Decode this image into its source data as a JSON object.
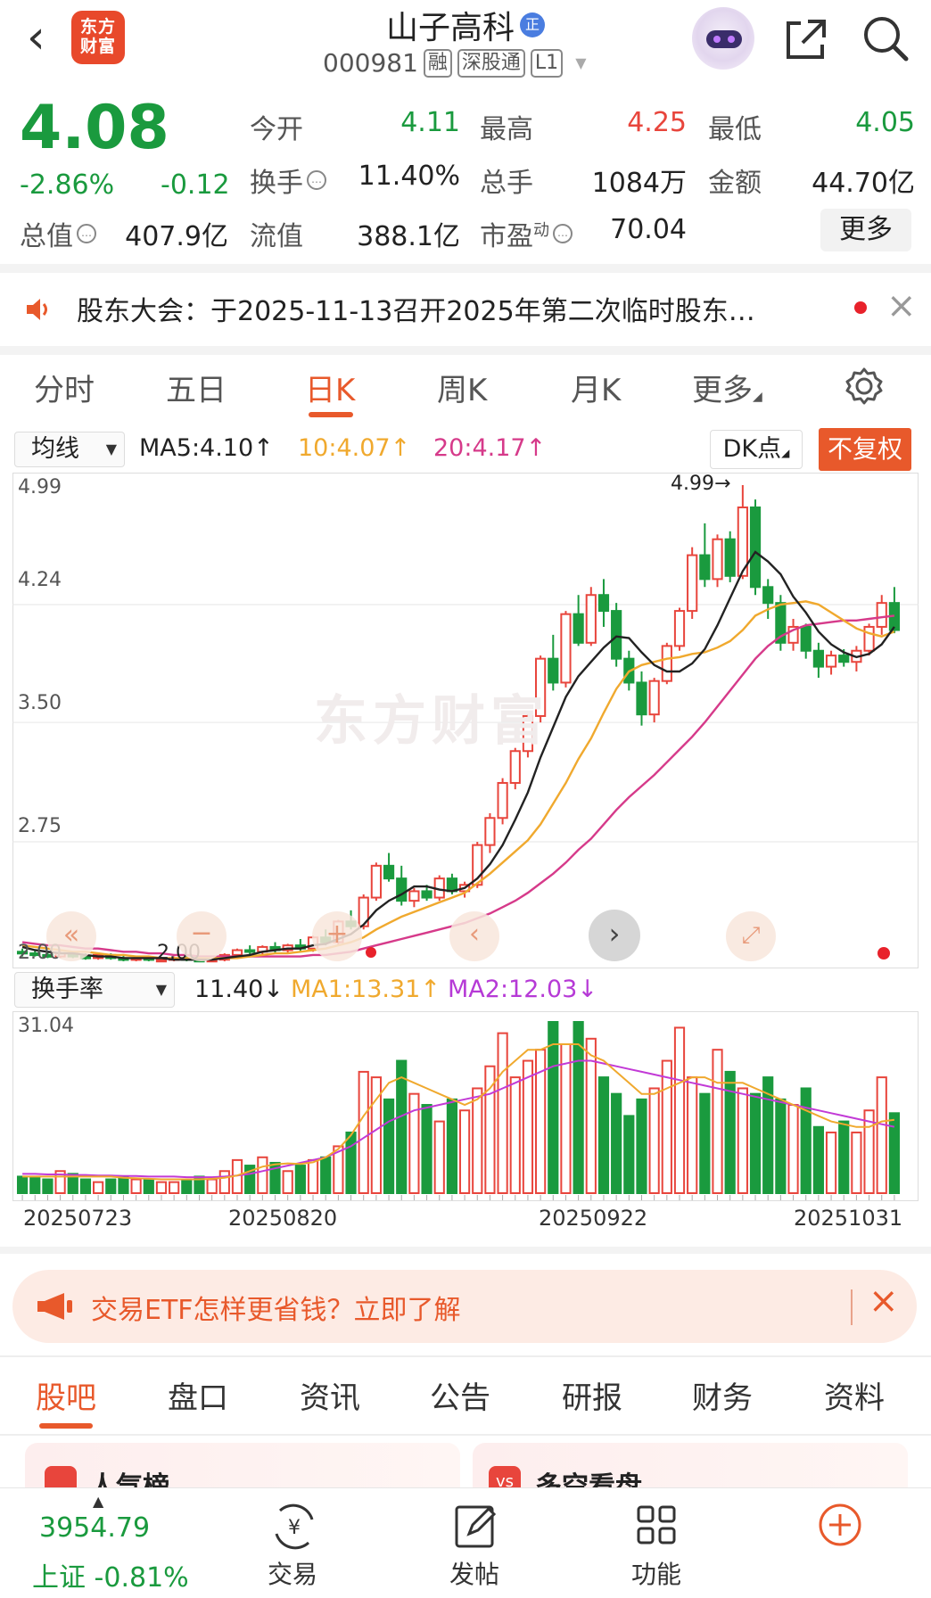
{
  "header": {
    "back": "‹",
    "logo": [
      "东方",
      "财富"
    ],
    "stock_name": "山子高科",
    "zheng_badge": "正",
    "code": "000981",
    "tags": [
      "融",
      "深股通",
      "L1"
    ]
  },
  "quote": {
    "price": "4.08",
    "change_pct": "-2.86%",
    "change": "-0.12",
    "fields": {
      "open_label": "今开",
      "open": "4.11",
      "high_label": "最高",
      "high": "4.25",
      "low_label": "最低",
      "low": "4.05",
      "turnover_label": "换手",
      "turnover": "11.40%",
      "volume_label": "总手",
      "volume": "1084万",
      "amount_label": "金额",
      "amount": "44.70亿",
      "mcap_label": "总值",
      "mcap": "407.9亿",
      "float_label": "流值",
      "float": "388.1亿",
      "pe_label": "市盈",
      "pe_sup": "动",
      "pe": "70.04"
    },
    "more": "更多"
  },
  "notice": {
    "text": "股东大会：于2025-11-13召开2025年第二次临时股东…",
    "close": "×"
  },
  "period_tabs": [
    "分时",
    "五日",
    "日K",
    "周K",
    "月K",
    "更多"
  ],
  "active_period": "日K",
  "ma_row": {
    "select": "均线",
    "ma5": "MA5:4.10↑",
    "ma10": "10:4.07↑",
    "ma20": "20:4.17↑",
    "dk": "DK点",
    "fq": "不复权",
    "colors": {
      "ma5": "#222222",
      "ma10": "#f0a92e",
      "ma20": "#d63a8a"
    }
  },
  "vol_row": {
    "select": "换手率",
    "value": "11.40↓",
    "ma1": "MA1:13.31↑",
    "ma2": "MA2:12.03↓"
  },
  "chart_data": {
    "type": "candlestick",
    "y_axis_labels": [
      "4.99",
      "4.24",
      "3.50",
      "2.75",
      "2.00"
    ],
    "ylim": [
      2.0,
      4.99
    ],
    "max_marker": "4.99→",
    "min_marker": "2.00",
    "watermark": "东方财富",
    "vol_axis_label": "31.04",
    "x_tick_labels": [
      "20250723",
      "20250820",
      "20250922",
      "20251031"
    ],
    "colors": {
      "up": "#e8453c",
      "down": "#1a9a3e"
    },
    "candles": [
      [
        2.06,
        2.08,
        2.03,
        2.05
      ],
      [
        2.05,
        2.07,
        2.03,
        2.04
      ],
      [
        2.04,
        2.06,
        2.02,
        2.03
      ],
      [
        2.03,
        2.06,
        2.02,
        2.05
      ],
      [
        2.05,
        2.06,
        2.02,
        2.03
      ],
      [
        2.03,
        2.05,
        2.01,
        2.02
      ],
      [
        2.02,
        2.05,
        2.01,
        2.04
      ],
      [
        2.04,
        2.05,
        2.01,
        2.02
      ],
      [
        2.02,
        2.04,
        2.0,
        2.01
      ],
      [
        2.01,
        2.03,
        2.0,
        2.02
      ],
      [
        2.02,
        2.03,
        2.0,
        2.01
      ],
      [
        2.01,
        2.02,
        2.0,
        2.01
      ],
      [
        2.01,
        2.03,
        2.0,
        2.02
      ],
      [
        2.02,
        2.03,
        2.0,
        2.01
      ],
      [
        2.01,
        2.02,
        2.0,
        2.0
      ],
      [
        2.0,
        2.02,
        2.0,
        2.01
      ],
      [
        2.01,
        2.05,
        2.0,
        2.04
      ],
      [
        2.04,
        2.08,
        2.02,
        2.07
      ],
      [
        2.07,
        2.1,
        2.04,
        2.06
      ],
      [
        2.06,
        2.1,
        2.04,
        2.09
      ],
      [
        2.09,
        2.12,
        2.05,
        2.07
      ],
      [
        2.07,
        2.11,
        2.05,
        2.1
      ],
      [
        2.1,
        2.14,
        2.06,
        2.08
      ],
      [
        2.08,
        2.16,
        2.06,
        2.15
      ],
      [
        2.15,
        2.2,
        2.1,
        2.12
      ],
      [
        2.12,
        2.26,
        2.1,
        2.25
      ],
      [
        2.25,
        2.32,
        2.2,
        2.22
      ],
      [
        2.22,
        2.42,
        2.2,
        2.4
      ],
      [
        2.4,
        2.62,
        2.38,
        2.6
      ],
      [
        2.6,
        2.68,
        2.5,
        2.52
      ],
      [
        2.52,
        2.6,
        2.35,
        2.38
      ],
      [
        2.38,
        2.46,
        2.34,
        2.44
      ],
      [
        2.44,
        2.48,
        2.38,
        2.4
      ],
      [
        2.4,
        2.54,
        2.38,
        2.52
      ],
      [
        2.52,
        2.55,
        2.42,
        2.44
      ],
      [
        2.44,
        2.5,
        2.4,
        2.48
      ],
      [
        2.48,
        2.75,
        2.46,
        2.73
      ],
      [
        2.73,
        2.93,
        2.68,
        2.9
      ],
      [
        2.9,
        3.15,
        2.86,
        3.12
      ],
      [
        3.12,
        3.34,
        3.08,
        3.32
      ],
      [
        3.32,
        3.56,
        3.28,
        3.54
      ],
      [
        3.54,
        3.92,
        3.5,
        3.9
      ],
      [
        3.9,
        4.05,
        3.7,
        3.75
      ],
      [
        3.75,
        4.2,
        3.72,
        4.18
      ],
      [
        4.18,
        4.3,
        3.98,
        4.0
      ],
      [
        4.0,
        4.35,
        3.98,
        4.3
      ],
      [
        4.3,
        4.4,
        4.1,
        4.2
      ],
      [
        4.2,
        4.25,
        3.85,
        3.9
      ],
      [
        3.9,
        3.95,
        3.7,
        3.75
      ],
      [
        3.75,
        3.82,
        3.48,
        3.55
      ],
      [
        3.55,
        3.78,
        3.5,
        3.76
      ],
      [
        3.76,
        4.0,
        3.74,
        3.98
      ],
      [
        3.98,
        4.22,
        3.95,
        4.2
      ],
      [
        4.2,
        4.6,
        4.15,
        4.55
      ],
      [
        4.55,
        4.75,
        4.35,
        4.4
      ],
      [
        4.4,
        4.68,
        4.35,
        4.65
      ],
      [
        4.65,
        4.7,
        4.38,
        4.42
      ],
      [
        4.42,
        4.99,
        4.4,
        4.85
      ],
      [
        4.85,
        4.9,
        4.3,
        4.35
      ],
      [
        4.35,
        4.4,
        4.15,
        4.25
      ],
      [
        4.25,
        4.3,
        3.95,
        4.0
      ],
      [
        4.0,
        4.15,
        3.95,
        4.1
      ],
      [
        4.1,
        4.12,
        3.9,
        3.95
      ],
      [
        3.95,
        4.0,
        3.78,
        3.85
      ],
      [
        3.85,
        3.95,
        3.8,
        3.92
      ],
      [
        3.92,
        3.96,
        3.85,
        3.88
      ],
      [
        3.88,
        3.98,
        3.82,
        3.95
      ],
      [
        3.95,
        4.12,
        3.92,
        4.1
      ],
      [
        4.1,
        4.3,
        4.05,
        4.25
      ],
      [
        4.25,
        4.35,
        4.06,
        4.08
      ]
    ],
    "ma5": [
      2.09,
      2.07,
      2.06,
      2.05,
      2.05,
      2.04,
      2.03,
      2.03,
      2.02,
      2.02,
      2.02,
      2.02,
      2.01,
      2.01,
      2.01,
      2.01,
      2.02,
      2.03,
      2.04,
      2.06,
      2.07,
      2.08,
      2.08,
      2.1,
      2.11,
      2.14,
      2.17,
      2.23,
      2.32,
      2.38,
      2.42,
      2.47,
      2.47,
      2.45,
      2.44,
      2.46,
      2.52,
      2.61,
      2.73,
      2.89,
      3.06,
      3.28,
      3.47,
      3.66,
      3.79,
      3.88,
      3.97,
      4.04,
      4.03,
      3.94,
      3.86,
      3.82,
      3.82,
      3.87,
      3.96,
      4.11,
      4.28,
      4.45,
      4.57,
      4.51,
      4.43,
      4.29,
      4.19,
      4.07,
      3.99,
      3.94,
      3.91,
      3.93,
      3.99,
      4.1
    ],
    "ma10": [
      2.1,
      2.09,
      2.08,
      2.07,
      2.06,
      2.06,
      2.05,
      2.04,
      2.04,
      2.03,
      2.03,
      2.02,
      2.02,
      2.02,
      2.02,
      2.02,
      2.02,
      2.02,
      2.03,
      2.04,
      2.05,
      2.05,
      2.06,
      2.07,
      2.08,
      2.1,
      2.12,
      2.15,
      2.2,
      2.24,
      2.28,
      2.31,
      2.34,
      2.37,
      2.4,
      2.43,
      2.49,
      2.55,
      2.62,
      2.69,
      2.76,
      2.86,
      2.99,
      3.12,
      3.27,
      3.4,
      3.56,
      3.71,
      3.82,
      3.86,
      3.88,
      3.9,
      3.91,
      3.93,
      3.94,
      3.97,
      4.01,
      4.08,
      4.17,
      4.21,
      4.24,
      4.25,
      4.26,
      4.24,
      4.19,
      4.14,
      4.09,
      4.06,
      4.04,
      4.07
    ],
    "ma20": [
      2.12,
      2.11,
      2.1,
      2.1,
      2.09,
      2.08,
      2.08,
      2.07,
      2.06,
      2.06,
      2.05,
      2.05,
      2.04,
      2.04,
      2.03,
      2.03,
      2.03,
      2.03,
      2.03,
      2.03,
      2.03,
      2.03,
      2.03,
      2.04,
      2.04,
      2.05,
      2.06,
      2.08,
      2.1,
      2.12,
      2.14,
      2.16,
      2.18,
      2.2,
      2.22,
      2.24,
      2.27,
      2.3,
      2.34,
      2.38,
      2.43,
      2.49,
      2.55,
      2.62,
      2.7,
      2.77,
      2.86,
      2.95,
      3.03,
      3.1,
      3.17,
      3.25,
      3.33,
      3.41,
      3.5,
      3.6,
      3.7,
      3.8,
      3.9,
      3.98,
      4.04,
      4.08,
      4.11,
      4.12,
      4.13,
      4.14,
      4.14,
      4.15,
      4.16,
      4.17
    ],
    "turnover": [
      3,
      3,
      2.5,
      4,
      3.5,
      2.5,
      2,
      2.5,
      3,
      2.5,
      2.5,
      2,
      2,
      2.5,
      3,
      2.5,
      4,
      6,
      5,
      6.5,
      5.5,
      4,
      5,
      6,
      6.5,
      8.5,
      11,
      22,
      21,
      17,
      24,
      18,
      16,
      13,
      17,
      15,
      19,
      23,
      29,
      21,
      24,
      26,
      31.04,
      27,
      31.04,
      28,
      21,
      18,
      14,
      17,
      19,
      24,
      30,
      21,
      18,
      26,
      22,
      19,
      18,
      21,
      17,
      16,
      19,
      12,
      11,
      13,
      11,
      15,
      21,
      14.5
    ],
    "turnover_ma1": [
      3,
      3,
      3,
      3,
      3,
      3,
      3,
      3,
      2.8,
      2.7,
      2.6,
      2.5,
      2.5,
      2.5,
      2.5,
      2.6,
      2.8,
      3.2,
      4,
      4.8,
      5.2,
      5.4,
      5.3,
      5.6,
      6.5,
      8,
      10.5,
      14,
      17,
      20,
      21,
      20,
      19,
      18,
      17,
      16,
      17,
      19,
      22,
      24,
      26,
      26,
      27,
      27,
      27,
      25,
      24,
      22,
      20,
      18,
      18,
      19,
      20,
      21,
      21,
      20,
      20,
      20,
      19,
      18,
      17,
      16,
      15,
      14,
      13,
      12.5,
      12,
      12,
      13,
      13.31
    ],
    "turnover_ma2": [
      3.5,
      3.5,
      3.4,
      3.4,
      3.3,
      3.3,
      3.2,
      3.2,
      3.1,
      3.1,
      3,
      3,
      3,
      2.9,
      2.9,
      2.9,
      3,
      3.2,
      3.5,
      4,
      4.5,
      5,
      5.5,
      6,
      6.5,
      7.5,
      8.5,
      10,
      11.5,
      13,
      14,
      15,
      15.5,
      16,
      16.5,
      17,
      17.5,
      18,
      19,
      20,
      21,
      22,
      23,
      23.5,
      24,
      24,
      23.5,
      23,
      22.5,
      22,
      21.5,
      21,
      20.5,
      20,
      19.5,
      19,
      18.5,
      18,
      17.5,
      17,
      16.5,
      16,
      15.5,
      15,
      14.5,
      14,
      13.5,
      13,
      12.5,
      12.03
    ]
  },
  "ad": {
    "text": "交易ETF怎样更省钱？立即了解",
    "close": "×"
  },
  "content_tabs": [
    "股吧",
    "盘口",
    "资讯",
    "公告",
    "研报",
    "财务",
    "资料"
  ],
  "active_content": "股吧",
  "cards": {
    "left": "人气榜",
    "right": "多空看盘"
  },
  "bottom_bar": {
    "index_value": "3954.79",
    "index_name": "上证",
    "index_change": "-0.81%",
    "items": [
      {
        "label": "交易",
        "icon": "yuan-cycle-icon"
      },
      {
        "label": "发帖",
        "icon": "edit-icon"
      },
      {
        "label": "功能",
        "icon": "grid-icon"
      },
      {
        "label": "",
        "icon": "add-circle-icon"
      }
    ]
  }
}
